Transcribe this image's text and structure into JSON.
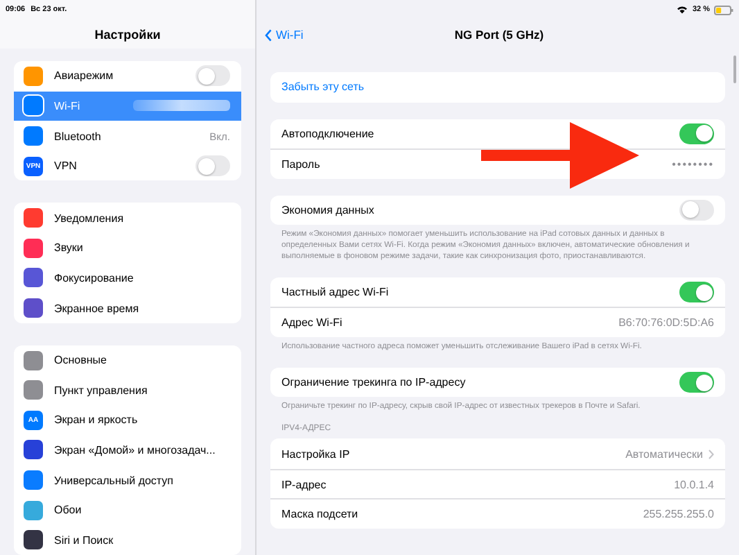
{
  "status_bar": {
    "time": "09:06",
    "date": "Вс 23 окт.",
    "battery": "32 %"
  },
  "sidebar": {
    "title": "Настройки",
    "groups": [
      {
        "items": [
          {
            "label": "Авиарежим",
            "color": "#ff9500",
            "kind": "toggle",
            "on": false,
            "selected": false
          },
          {
            "label": "Wi-Fi",
            "color": "#007aff",
            "kind": "hidden-value",
            "selected": true
          },
          {
            "label": "Bluetooth",
            "color": "#007aff",
            "kind": "value",
            "value": "Вкл.",
            "selected": false
          },
          {
            "label": "VPN",
            "color": "#0a60ff",
            "icon_text": "VPN",
            "kind": "toggle",
            "on": false,
            "selected": false
          }
        ]
      },
      {
        "items": [
          {
            "label": "Уведомления",
            "color": "#ff3b30",
            "kind": "plain",
            "selected": false
          },
          {
            "label": "Звуки",
            "color": "#ff2d55",
            "kind": "plain",
            "selected": false
          },
          {
            "label": "Фокусирование",
            "color": "#5856d6",
            "kind": "plain",
            "selected": false
          },
          {
            "label": "Экранное время",
            "color": "#5e4fc9",
            "kind": "plain",
            "selected": false
          }
        ]
      },
      {
        "items": [
          {
            "label": "Основные",
            "color": "#8e8e93",
            "kind": "plain",
            "selected": false
          },
          {
            "label": "Пункт управления",
            "color": "#8e8e93",
            "kind": "plain",
            "selected": false
          },
          {
            "label": "Экран и яркость",
            "color": "#007aff",
            "icon_text": "AA",
            "kind": "plain",
            "selected": false
          },
          {
            "label": "Экран «Домой» и многозадач...",
            "color": "#2741d8",
            "kind": "plain",
            "selected": false
          },
          {
            "label": "Универсальный доступ",
            "color": "#0a7cff",
            "kind": "plain",
            "selected": false
          },
          {
            "label": "Обои",
            "color": "#36aadc",
            "kind": "plain",
            "selected": false
          },
          {
            "label": "Siri и Поиск",
            "color": "#333344",
            "kind": "plain",
            "selected": false
          }
        ]
      }
    ]
  },
  "detail": {
    "back": "Wi-Fi",
    "title": "NG Port (5 GHz)",
    "sections": [
      {
        "rows": [
          {
            "kind": "link",
            "label": "Забыть эту сеть"
          }
        ]
      },
      {
        "rows": [
          {
            "kind": "toggle",
            "label": "Автоподключение",
            "on": true
          },
          {
            "kind": "value",
            "label": "Пароль",
            "value": "••••••••"
          }
        ]
      },
      {
        "rows": [
          {
            "kind": "toggle",
            "label": "Экономия данных",
            "on": false
          }
        ],
        "footer": "Режим «Экономия данных» помогает уменьшить использование на iPad сотовых данных и данных в определенных Вами сетях Wi-Fi. Когда режим «Экономия данных» включен, автоматические обновления и выполняемые в фоновом режиме задачи, такие как синхронизация фото, приостанавливаются."
      },
      {
        "rows": [
          {
            "kind": "toggle",
            "label": "Частный адрес Wi-Fi",
            "on": true
          },
          {
            "kind": "value",
            "label": "Адрес Wi-Fi",
            "value": "B6:70:76:0D:5D:A6"
          }
        ],
        "footer": "Использование частного адреса поможет уменьшить отслеживание Вашего iPad в сетях Wi-Fi."
      },
      {
        "rows": [
          {
            "kind": "toggle",
            "label": "Ограничение трекинга по IP-адресу",
            "on": true
          }
        ],
        "footer": "Ограничьте трекинг по IP-адресу, скрыв свой IP-адрес от известных трекеров в Почте и Safari."
      },
      {
        "header": "IPV4-АДРЕС",
        "rows": [
          {
            "kind": "disclosure",
            "label": "Настройка IP",
            "value": "Автоматически"
          },
          {
            "kind": "value",
            "label": "IP-адрес",
            "value": "10.0.1.4"
          },
          {
            "kind": "value",
            "label": "Маска подсети",
            "value": "255.255.255.0"
          }
        ]
      }
    ]
  }
}
